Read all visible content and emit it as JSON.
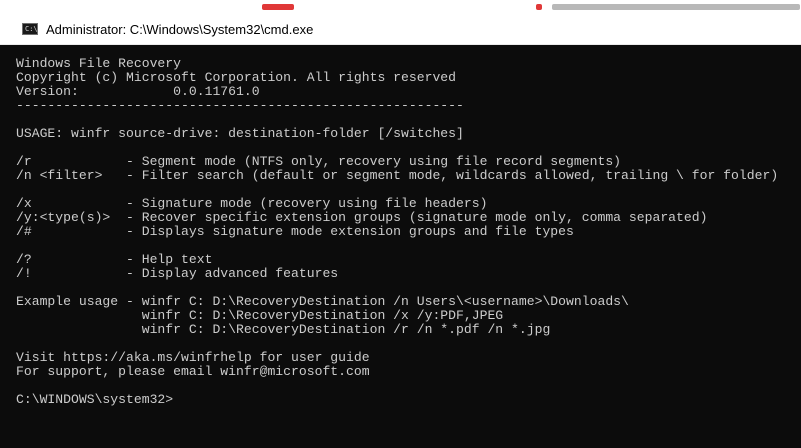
{
  "window": {
    "title": "Administrator: C:\\Windows\\System32\\cmd.exe",
    "icon": "cmd-icon",
    "icon_glyph": "C:\\"
  },
  "console": {
    "background": "#0c0c0c",
    "text_color": "#cccccc",
    "lines": [
      "Windows File Recovery",
      "Copyright (c) Microsoft Corporation. All rights reserved",
      "Version:            0.0.11761.0",
      "---------------------------------------------------------",
      "",
      "USAGE: winfr source-drive: destination-folder [/switches]",
      "",
      "/r            - Segment mode (NTFS only, recovery using file record segments)",
      "/n <filter>   - Filter search (default or segment mode, wildcards allowed, trailing \\ for folder)",
      "",
      "/x            - Signature mode (recovery using file headers)",
      "/y:<type(s)>  - Recover specific extension groups (signature mode only, comma separated)",
      "/#            - Displays signature mode extension groups and file types",
      "",
      "/?            - Help text",
      "/!            - Display advanced features",
      "",
      "Example usage - winfr C: D:\\RecoveryDestination /n Users\\<username>\\Downloads\\",
      "                winfr C: D:\\RecoveryDestination /x /y:PDF,JPEG",
      "                winfr C: D:\\RecoveryDestination /r /n *.pdf /n *.jpg",
      "",
      "Visit https://aka.ms/winfrhelp for user guide",
      "For support, please email winfr@microsoft.com",
      "",
      "C:\\WINDOWS\\system32>"
    ]
  }
}
